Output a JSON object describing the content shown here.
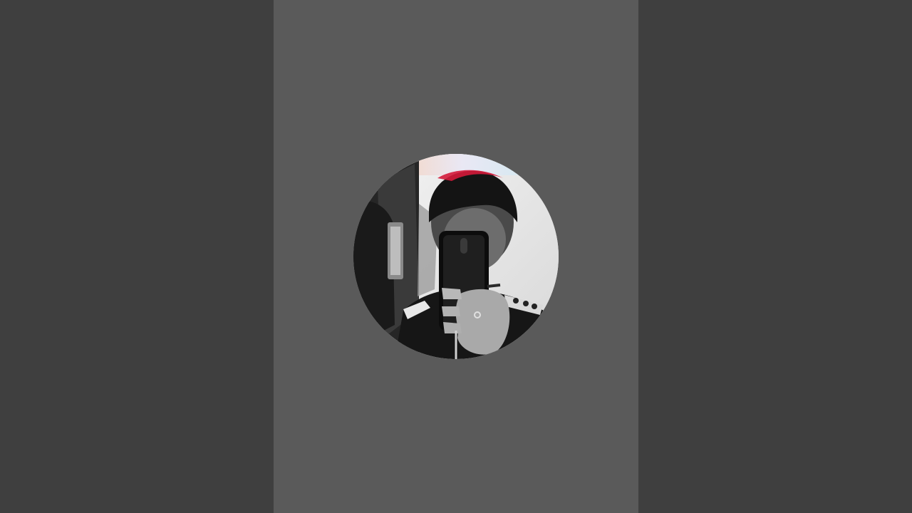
{
  "colors": {
    "letterbox": "#3f3f3f",
    "frame": "#5a5a5a"
  },
  "avatar": {
    "icon": "profile-photo-icon",
    "description_visible": false
  }
}
